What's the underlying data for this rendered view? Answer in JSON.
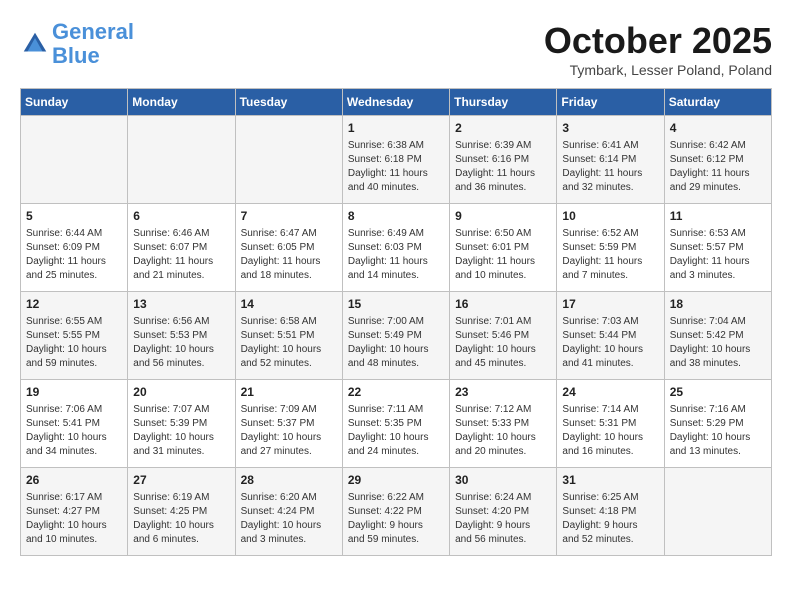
{
  "header": {
    "logo_line1": "General",
    "logo_line2": "Blue",
    "month": "October 2025",
    "location": "Tymbark, Lesser Poland, Poland"
  },
  "days_of_week": [
    "Sunday",
    "Monday",
    "Tuesday",
    "Wednesday",
    "Thursday",
    "Friday",
    "Saturday"
  ],
  "weeks": [
    [
      {
        "day": "",
        "info": ""
      },
      {
        "day": "",
        "info": ""
      },
      {
        "day": "",
        "info": ""
      },
      {
        "day": "1",
        "info": "Sunrise: 6:38 AM\nSunset: 6:18 PM\nDaylight: 11 hours\nand 40 minutes."
      },
      {
        "day": "2",
        "info": "Sunrise: 6:39 AM\nSunset: 6:16 PM\nDaylight: 11 hours\nand 36 minutes."
      },
      {
        "day": "3",
        "info": "Sunrise: 6:41 AM\nSunset: 6:14 PM\nDaylight: 11 hours\nand 32 minutes."
      },
      {
        "day": "4",
        "info": "Sunrise: 6:42 AM\nSunset: 6:12 PM\nDaylight: 11 hours\nand 29 minutes."
      }
    ],
    [
      {
        "day": "5",
        "info": "Sunrise: 6:44 AM\nSunset: 6:09 PM\nDaylight: 11 hours\nand 25 minutes."
      },
      {
        "day": "6",
        "info": "Sunrise: 6:46 AM\nSunset: 6:07 PM\nDaylight: 11 hours\nand 21 minutes."
      },
      {
        "day": "7",
        "info": "Sunrise: 6:47 AM\nSunset: 6:05 PM\nDaylight: 11 hours\nand 18 minutes."
      },
      {
        "day": "8",
        "info": "Sunrise: 6:49 AM\nSunset: 6:03 PM\nDaylight: 11 hours\nand 14 minutes."
      },
      {
        "day": "9",
        "info": "Sunrise: 6:50 AM\nSunset: 6:01 PM\nDaylight: 11 hours\nand 10 minutes."
      },
      {
        "day": "10",
        "info": "Sunrise: 6:52 AM\nSunset: 5:59 PM\nDaylight: 11 hours\nand 7 minutes."
      },
      {
        "day": "11",
        "info": "Sunrise: 6:53 AM\nSunset: 5:57 PM\nDaylight: 11 hours\nand 3 minutes."
      }
    ],
    [
      {
        "day": "12",
        "info": "Sunrise: 6:55 AM\nSunset: 5:55 PM\nDaylight: 10 hours\nand 59 minutes."
      },
      {
        "day": "13",
        "info": "Sunrise: 6:56 AM\nSunset: 5:53 PM\nDaylight: 10 hours\nand 56 minutes."
      },
      {
        "day": "14",
        "info": "Sunrise: 6:58 AM\nSunset: 5:51 PM\nDaylight: 10 hours\nand 52 minutes."
      },
      {
        "day": "15",
        "info": "Sunrise: 7:00 AM\nSunset: 5:49 PM\nDaylight: 10 hours\nand 48 minutes."
      },
      {
        "day": "16",
        "info": "Sunrise: 7:01 AM\nSunset: 5:46 PM\nDaylight: 10 hours\nand 45 minutes."
      },
      {
        "day": "17",
        "info": "Sunrise: 7:03 AM\nSunset: 5:44 PM\nDaylight: 10 hours\nand 41 minutes."
      },
      {
        "day": "18",
        "info": "Sunrise: 7:04 AM\nSunset: 5:42 PM\nDaylight: 10 hours\nand 38 minutes."
      }
    ],
    [
      {
        "day": "19",
        "info": "Sunrise: 7:06 AM\nSunset: 5:41 PM\nDaylight: 10 hours\nand 34 minutes."
      },
      {
        "day": "20",
        "info": "Sunrise: 7:07 AM\nSunset: 5:39 PM\nDaylight: 10 hours\nand 31 minutes."
      },
      {
        "day": "21",
        "info": "Sunrise: 7:09 AM\nSunset: 5:37 PM\nDaylight: 10 hours\nand 27 minutes."
      },
      {
        "day": "22",
        "info": "Sunrise: 7:11 AM\nSunset: 5:35 PM\nDaylight: 10 hours\nand 24 minutes."
      },
      {
        "day": "23",
        "info": "Sunrise: 7:12 AM\nSunset: 5:33 PM\nDaylight: 10 hours\nand 20 minutes."
      },
      {
        "day": "24",
        "info": "Sunrise: 7:14 AM\nSunset: 5:31 PM\nDaylight: 10 hours\nand 16 minutes."
      },
      {
        "day": "25",
        "info": "Sunrise: 7:16 AM\nSunset: 5:29 PM\nDaylight: 10 hours\nand 13 minutes."
      }
    ],
    [
      {
        "day": "26",
        "info": "Sunrise: 6:17 AM\nSunset: 4:27 PM\nDaylight: 10 hours\nand 10 minutes."
      },
      {
        "day": "27",
        "info": "Sunrise: 6:19 AM\nSunset: 4:25 PM\nDaylight: 10 hours\nand 6 minutes."
      },
      {
        "day": "28",
        "info": "Sunrise: 6:20 AM\nSunset: 4:24 PM\nDaylight: 10 hours\nand 3 minutes."
      },
      {
        "day": "29",
        "info": "Sunrise: 6:22 AM\nSunset: 4:22 PM\nDaylight: 9 hours\nand 59 minutes."
      },
      {
        "day": "30",
        "info": "Sunrise: 6:24 AM\nSunset: 4:20 PM\nDaylight: 9 hours\nand 56 minutes."
      },
      {
        "day": "31",
        "info": "Sunrise: 6:25 AM\nSunset: 4:18 PM\nDaylight: 9 hours\nand 52 minutes."
      },
      {
        "day": "",
        "info": ""
      }
    ]
  ]
}
